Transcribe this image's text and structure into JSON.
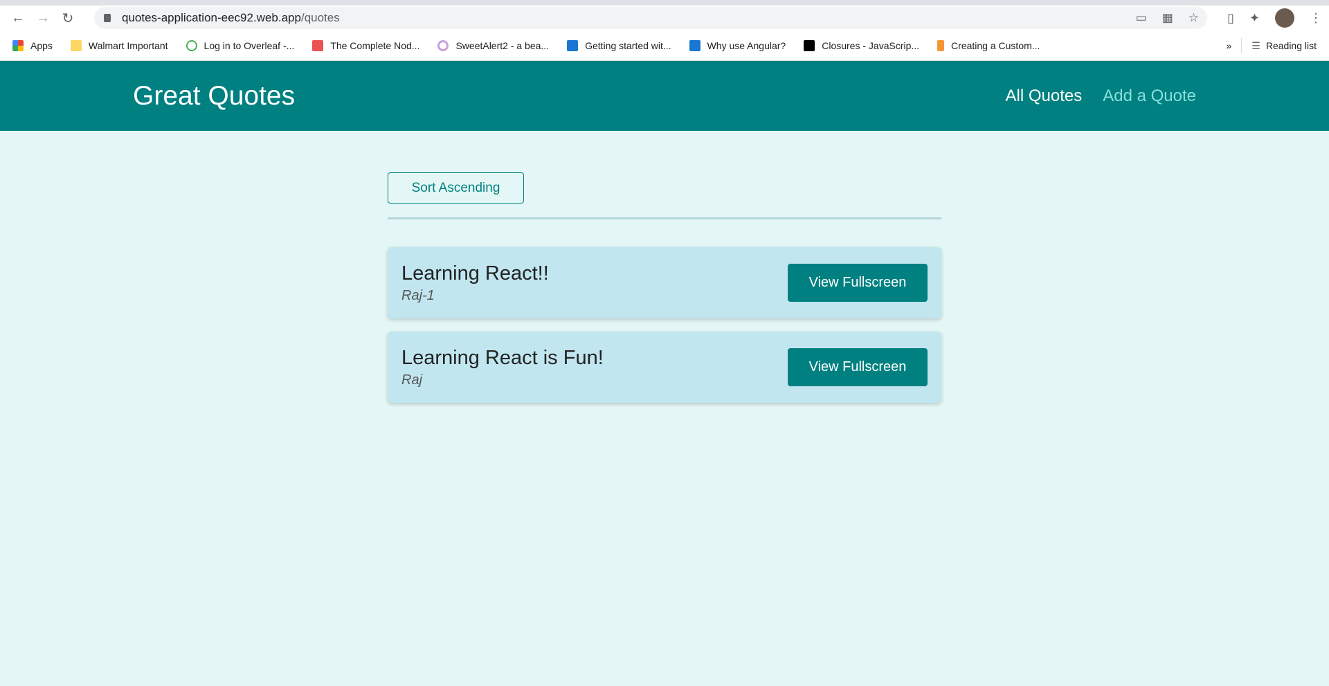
{
  "browser": {
    "url_host": "quotes-application-eec92.web.app",
    "url_path": "/quotes",
    "bookmarks": [
      {
        "label": "Apps",
        "color": "#ea4335"
      },
      {
        "label": "Walmart Important",
        "color": "#fdd663"
      },
      {
        "label": "Log in to Overleaf -...",
        "color": "#4caf50"
      },
      {
        "label": "The Complete Nod...",
        "color": "#ec5252"
      },
      {
        "label": "SweetAlert2 - a bea...",
        "color": "#c9a0dc"
      },
      {
        "label": "Getting started wit...",
        "color": "#1976d2"
      },
      {
        "label": "Why use Angular?",
        "color": "#1976d2"
      },
      {
        "label": "Closures - JavaScrip...",
        "color": "#000000"
      },
      {
        "label": "Creating a Custom...",
        "color": "#f79433"
      }
    ],
    "more": "»",
    "reading_list": "Reading list"
  },
  "header": {
    "title": "Great Quotes",
    "nav": [
      {
        "label": "All Quotes"
      },
      {
        "label": "Add a Quote"
      }
    ]
  },
  "main": {
    "sort_label": "Sort Ascending",
    "quotes": [
      {
        "text": "Learning React!!",
        "author": "Raj-1",
        "button": "View Fullscreen"
      },
      {
        "text": "Learning React is Fun!",
        "author": "Raj",
        "button": "View Fullscreen"
      }
    ]
  },
  "colors": {
    "brand": "#008080",
    "background": "#e4f7f6",
    "card": "#c1e6ef"
  }
}
